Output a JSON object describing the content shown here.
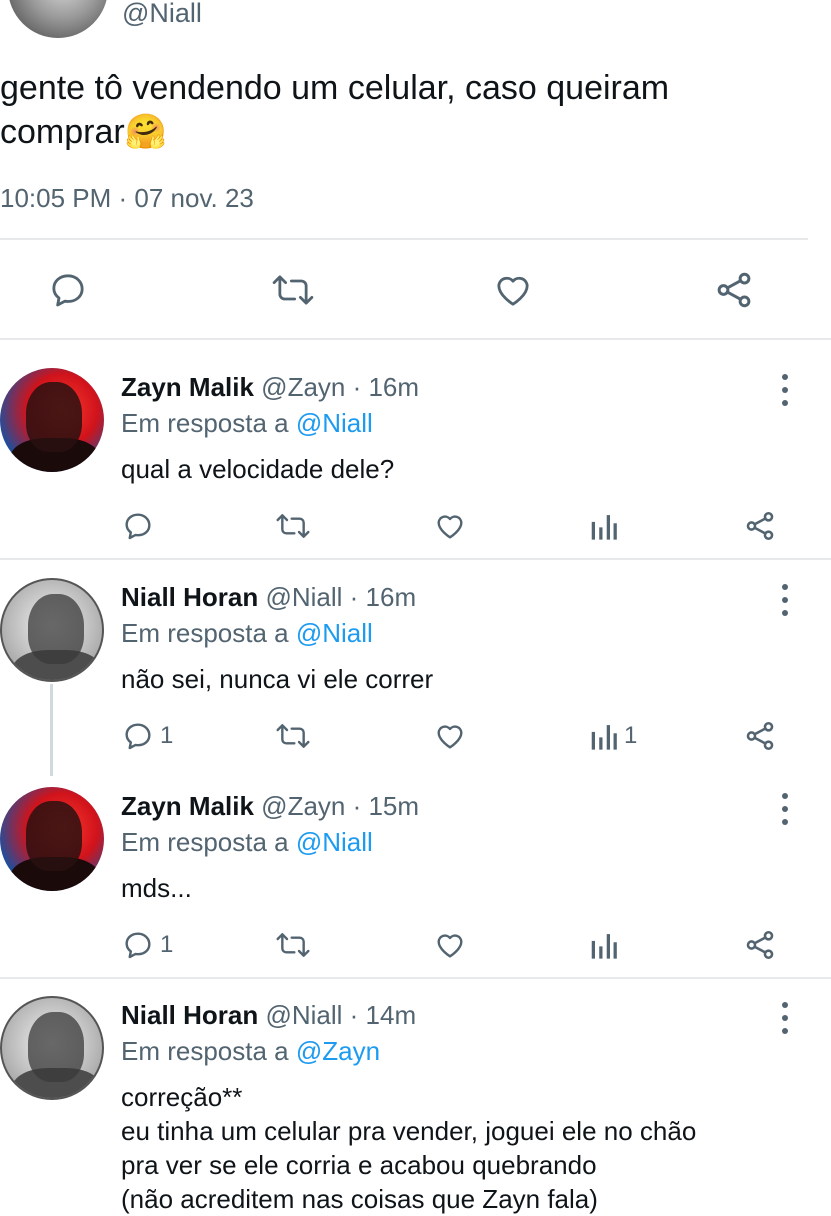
{
  "main_tweet": {
    "handle": "@Niall",
    "text": "gente tô vendendo um celular, caso queiram comprar🤗",
    "timestamp": "10:05 PM · 07 nov. 23",
    "actions": [
      "reply-icon",
      "retweet-icon",
      "like-icon",
      "share-icon"
    ]
  },
  "replies": [
    {
      "name": "Zayn Malik",
      "handle": "@Zayn · 16m",
      "reply_prefix": "Em resposta a ",
      "reply_to": "@Niall",
      "text": "qual a velocidade dele?",
      "reply_count": "",
      "views": ""
    },
    {
      "name": "Niall Horan",
      "handle": "@Niall · 16m",
      "reply_prefix": "Em resposta a ",
      "reply_to": "@Niall",
      "text": "não sei, nunca vi ele correr",
      "reply_count": "1",
      "views": "1"
    },
    {
      "name": "Zayn Malik",
      "handle": "@Zayn · 15m",
      "reply_prefix": "Em resposta a ",
      "reply_to": "@Niall",
      "text": "mds...",
      "reply_count": "1",
      "views": ""
    },
    {
      "name": "Niall Horan",
      "handle": "@Niall · 14m",
      "reply_prefix": "Em resposta a ",
      "reply_to": "@Zayn",
      "text_lines": [
        "correção**",
        "eu tinha um celular pra vender, joguei ele no chão",
        "pra ver se ele corria e acabou quebrando",
        "(não acreditem nas coisas que Zayn fala)"
      ]
    }
  ],
  "colors": {
    "text": "#0f1419",
    "muted": "#536471",
    "link": "#1d9bf0",
    "divider": "#e7e9ea"
  }
}
